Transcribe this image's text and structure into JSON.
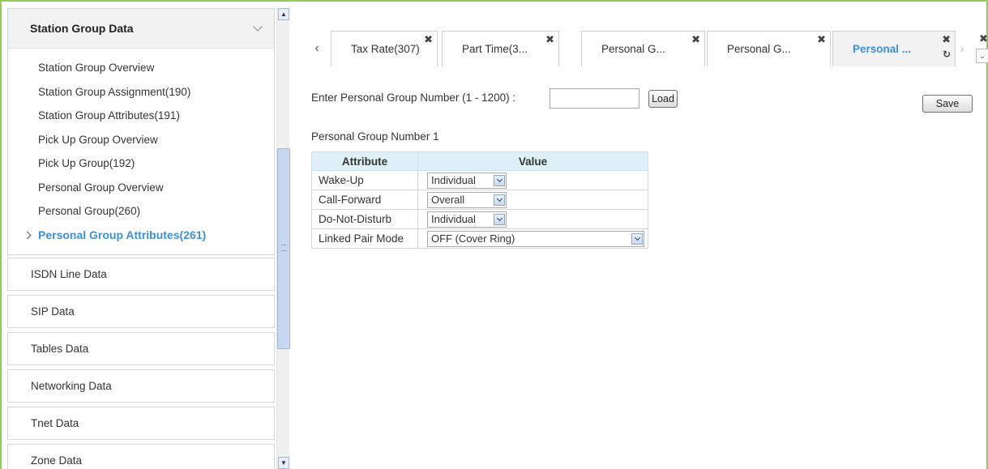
{
  "sidebar": {
    "group": {
      "title": "Station Group Data",
      "items": [
        {
          "label": "Station Group Overview"
        },
        {
          "label": "Station Group Assignment(190)"
        },
        {
          "label": "Station Group Attributes(191)"
        },
        {
          "label": "Pick Up Group Overview"
        },
        {
          "label": "Pick Up Group(192)"
        },
        {
          "label": "Personal Group Overview"
        },
        {
          "label": "Personal Group(260)"
        },
        {
          "label": "Personal Group Attributes(261)",
          "active": true
        }
      ]
    },
    "sections": [
      {
        "label": "ISDN Line Data"
      },
      {
        "label": "SIP Data"
      },
      {
        "label": "Tables Data"
      },
      {
        "label": "Networking Data"
      },
      {
        "label": "Tnet Data"
      },
      {
        "label": "Zone Data"
      }
    ]
  },
  "tabs": [
    {
      "label": "Tax Rate(307)"
    },
    {
      "label": "Part Time(3..."
    },
    {
      "label": "Personal G..."
    },
    {
      "label": "Personal G..."
    },
    {
      "label": "Personal ...",
      "active": true
    }
  ],
  "form": {
    "prompt": "Enter Personal Group Number (1 - 1200) :",
    "input_value": "",
    "load_label": "Load",
    "save_label": "Save"
  },
  "group_title": "Personal Group Number 1",
  "table": {
    "headers": [
      "Attribute",
      "Value"
    ],
    "rows": [
      {
        "attribute": "Wake-Up",
        "value": "Individual"
      },
      {
        "attribute": "Call-Forward",
        "value": "Overall"
      },
      {
        "attribute": "Do-Not-Disturb",
        "value": "Individual"
      },
      {
        "attribute": "Linked Pair Mode",
        "value": "OFF (Cover Ring)"
      }
    ]
  },
  "icons": {
    "close": "close-icon",
    "refresh": "refresh-icon",
    "chevron_down": "chevron-down-icon",
    "chevron_right": "chevron-right-icon"
  },
  "colors": {
    "accent": "#3d8fe0",
    "frame": "#8fce52",
    "table_header": "#dff0f8"
  }
}
